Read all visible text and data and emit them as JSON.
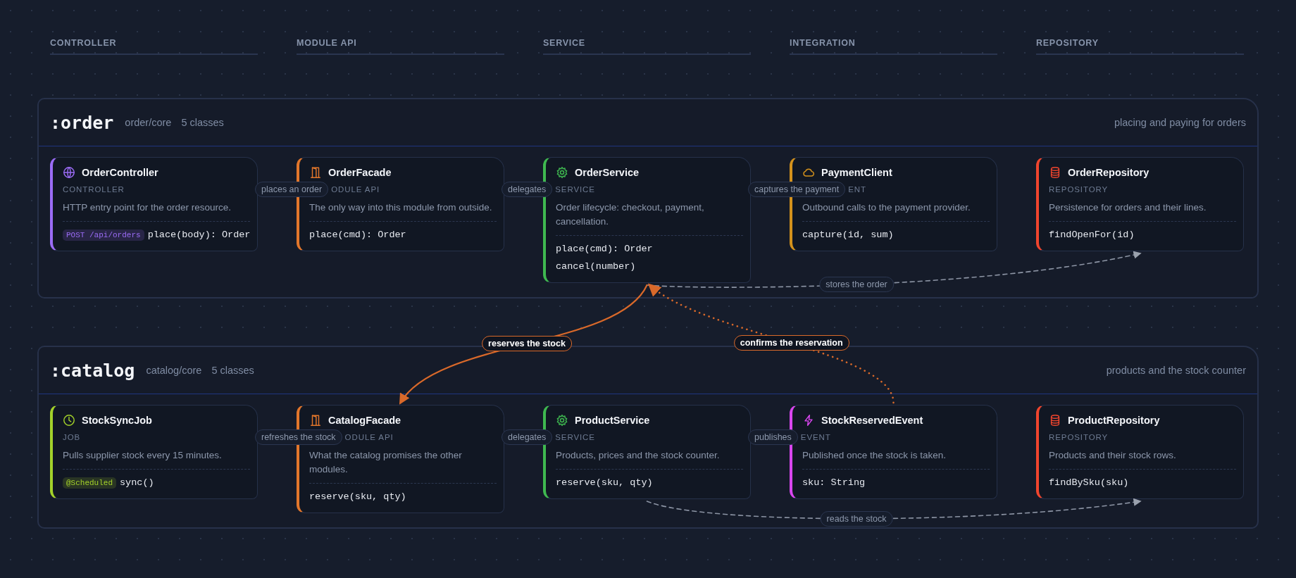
{
  "columns": [
    "CONTROLLER",
    "MODULE API",
    "SERVICE",
    "INTEGRATION",
    "REPOSITORY"
  ],
  "modules": [
    {
      "name": ":order",
      "path": "order/core",
      "count": "5 classes",
      "summary": "placing and paying for orders",
      "classes": [
        {
          "kind": "controller",
          "color": "#9b6cf6",
          "name": "OrderController",
          "role": "CONTROLLER",
          "description": "HTTP entry point for the order resource.",
          "members": [
            {
              "badge": "POST /api/orders",
              "signature": "place(body): Order"
            }
          ]
        },
        {
          "kind": "facade",
          "color": "#e2762b",
          "incoming": "places an order",
          "name": "OrderFacade",
          "role": "ODULE API",
          "description": "The only way into this module from outside.",
          "members": [
            {
              "signature": "place(cmd): Order"
            }
          ]
        },
        {
          "kind": "service",
          "color": "#3fb950",
          "incoming": "delegates",
          "name": "OrderService",
          "role": "SERVICE",
          "description": "Order lifecycle: checkout, payment, cancellation.",
          "members": [
            {
              "signature": "place(cmd): Order"
            },
            {
              "signature": "cancel(number)"
            }
          ]
        },
        {
          "kind": "client",
          "color": "#d4921c",
          "incoming": "captures the payment",
          "name": "PaymentClient",
          "role": "ENT",
          "description": "Outbound calls to the payment provider.",
          "members": [
            {
              "signature": "capture(id, sum)"
            }
          ]
        },
        {
          "kind": "repository",
          "color": "#f0452e",
          "name": "OrderRepository",
          "role": "REPOSITORY",
          "description": "Persistence for orders and their lines.",
          "members": [
            {
              "signature": "findOpenFor(id)"
            }
          ]
        }
      ]
    },
    {
      "name": ":catalog",
      "path": "catalog/core",
      "count": "5 classes",
      "summary": "products and the stock counter",
      "classes": [
        {
          "kind": "job",
          "color": "#a3d12a",
          "name": "StockSyncJob",
          "role": "JOB",
          "description": "Pulls supplier stock every 15 minutes.",
          "members": [
            {
              "badge": "@Scheduled",
              "signature": "sync()"
            }
          ]
        },
        {
          "kind": "facade",
          "color": "#e2762b",
          "incoming": "refreshes the stock",
          "name": "CatalogFacade",
          "role": "ODULE API",
          "description": "What the catalog promises the other modules.",
          "members": [
            {
              "signature": "reserve(sku, qty)"
            }
          ]
        },
        {
          "kind": "service",
          "color": "#3fb950",
          "incoming": "delegates",
          "name": "ProductService",
          "role": "SERVICE",
          "description": "Products, prices and the stock counter.",
          "members": [
            {
              "signature": "reserve(sku, qty)"
            }
          ]
        },
        {
          "kind": "event",
          "color": "#d946ef",
          "incoming": "publishes",
          "name": "StockReservedEvent",
          "role": "EVENT",
          "description": "Published once the stock is taken.",
          "members": [
            {
              "signature": "sku: String"
            }
          ]
        },
        {
          "kind": "repository",
          "color": "#f0452e",
          "name": "ProductRepository",
          "role": "REPOSITORY",
          "description": "Products and their stock rows.",
          "members": [
            {
              "signature": "findBySku(sku)"
            }
          ]
        }
      ]
    }
  ],
  "links": [
    {
      "label": "stores the order",
      "kind": "call"
    },
    {
      "label": "reserves the stock",
      "kind": "cross"
    },
    {
      "label": "confirms the reservation",
      "kind": "event"
    },
    {
      "label": "reads the stock",
      "kind": "call"
    }
  ]
}
